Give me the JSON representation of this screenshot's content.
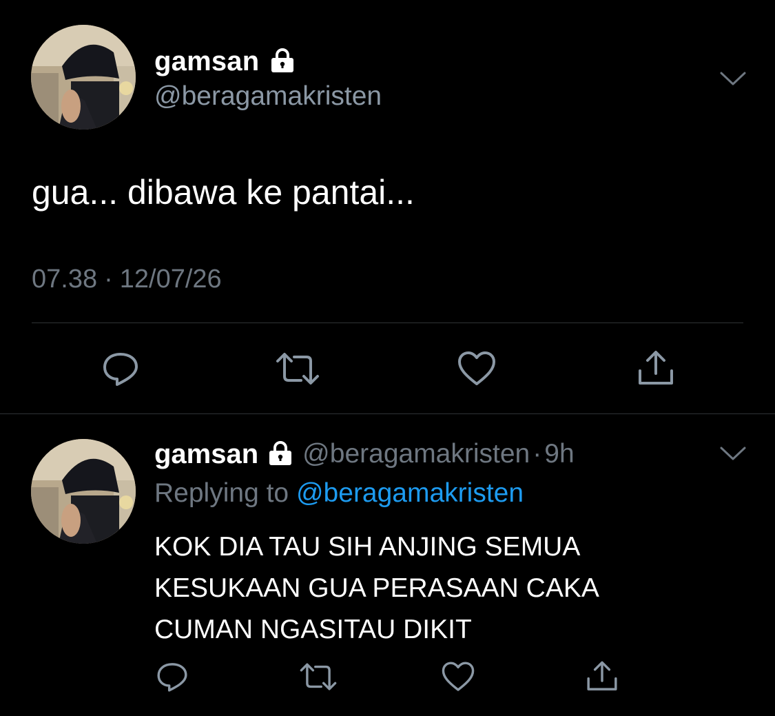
{
  "main_tweet": {
    "display_name": "gamsan",
    "handle": "@beragamakristen",
    "text": "gua... dibawa ke pantai...",
    "time": "07.38",
    "date_separator": "·",
    "date": "12/07/26",
    "icons": {
      "lock": "lock-icon",
      "menu": "chevron-down-icon",
      "reply": "reply-icon",
      "retweet": "retweet-icon",
      "like": "heart-icon",
      "share": "share-icon"
    }
  },
  "reply_tweet": {
    "display_name": "gamsan",
    "handle": "@beragamakristen",
    "separator": "·",
    "relative_time": "9h",
    "replying_prefix": "Replying to",
    "replying_to": "@beragamakristen",
    "text_lines": [
      "KOK DIA TAU SIH ANJING SEMUA",
      "KESUKAAN GUA PERASAAN CAKA",
      "CUMAN NGASITAU DIKIT"
    ]
  },
  "colors": {
    "background": "#000000",
    "primary_text": "#ffffff",
    "secondary_text": "#6e7781",
    "link": "#1d9bf0",
    "divider": "#2f3336",
    "icon": "#8b98a5"
  }
}
